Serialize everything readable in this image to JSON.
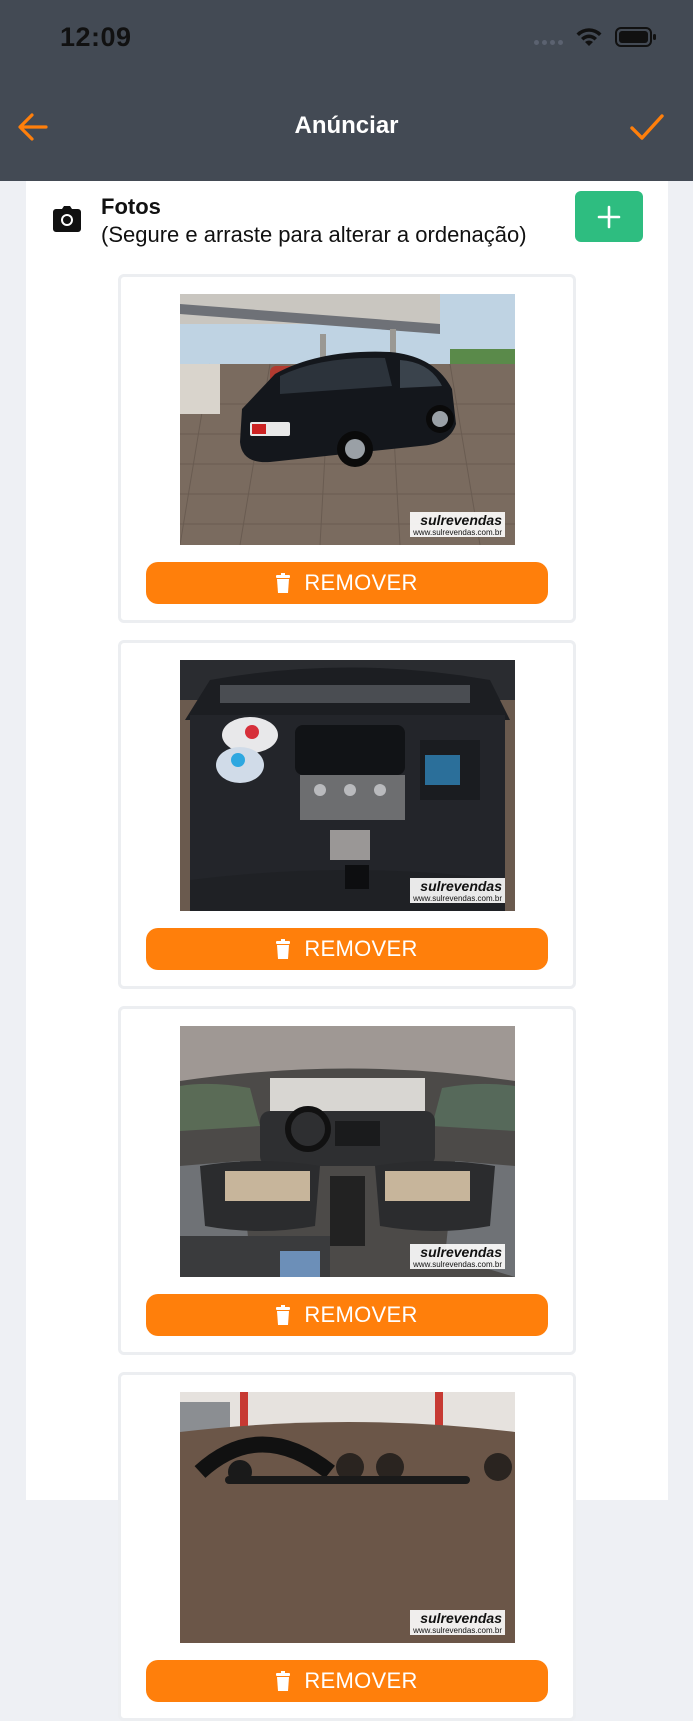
{
  "status_bar": {
    "time": "12:09"
  },
  "nav": {
    "title": "Anúnciar",
    "back_icon": "arrow-left-icon",
    "confirm_icon": "check-icon"
  },
  "colors": {
    "header": "#434a54",
    "accent": "#ff7f0b",
    "add": "#2ebd80"
  },
  "photos_section": {
    "icon": "camera-icon",
    "title": "Fotos",
    "subtitle": "(Segure e arraste para alterar a ordenação)",
    "add_icon": "plus-icon"
  },
  "photos": [
    {
      "subject": "car-exterior",
      "remove_label": "REMOVER",
      "watermark_brand": "sulrevendas",
      "watermark_url": "www.sulrevendas.com.br"
    },
    {
      "subject": "engine-bay",
      "remove_label": "REMOVER",
      "watermark_brand": "sulrevendas",
      "watermark_url": "www.sulrevendas.com.br"
    },
    {
      "subject": "interior",
      "remove_label": "REMOVER",
      "watermark_brand": "sulrevendas",
      "watermark_url": "www.sulrevendas.com.br"
    },
    {
      "subject": "dashboard",
      "remove_label": "REMOVER",
      "watermark_brand": "sulrevendas",
      "watermark_url": "www.sulrevendas.com.br"
    }
  ]
}
